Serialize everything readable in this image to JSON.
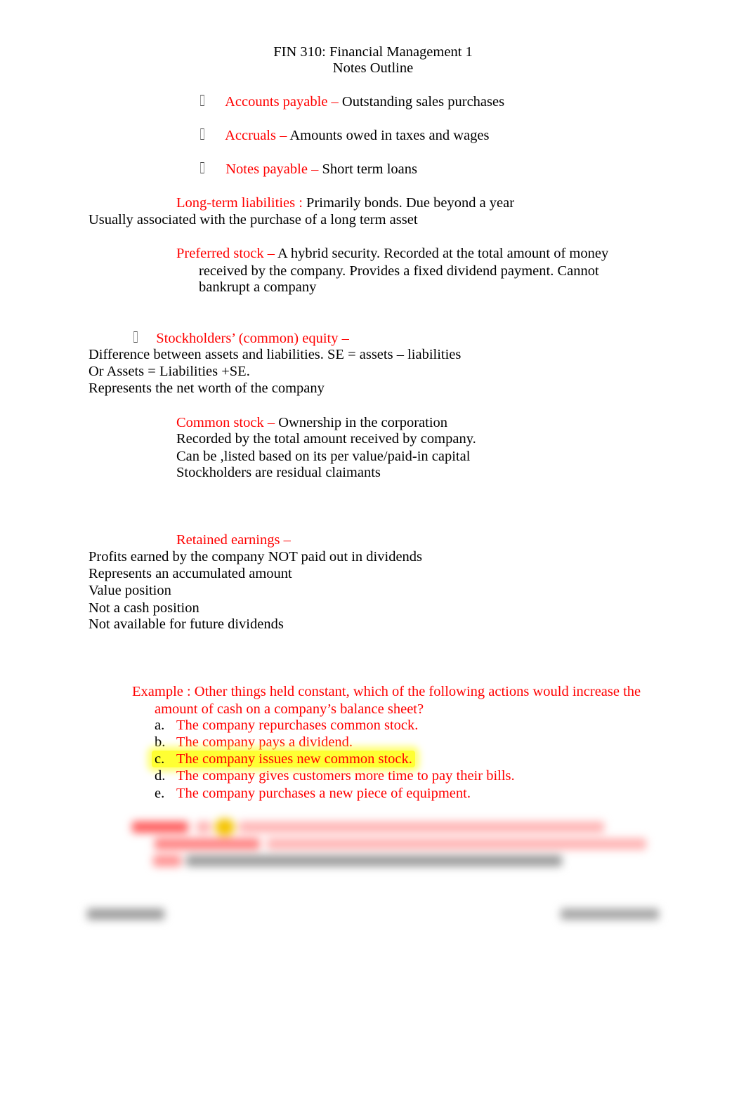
{
  "header": {
    "title": "FIN 310: Financial Management 1",
    "subtitle": "Notes Outline"
  },
  "current_liabilities": [
    {
      "term": "Accounts payable",
      "sep": " – ",
      "definition": "Outstanding sales purchases",
      "bullet_icon": "square-bullet"
    },
    {
      "term": "Accruals",
      "sep": " – ",
      "definition": "Amounts owed in taxes and wages",
      "bullet_icon": "square-bullet"
    },
    {
      "term": "Notes payable",
      "sep": " – ",
      "definition": "Short term loans",
      "bullet_icon": "square-bullet"
    }
  ],
  "long_term": {
    "term": "Long-term liabilities",
    "sep": " : ",
    "definition": "Primarily bonds. Due beyond a year",
    "note": "Usually associated with the purchase of a long term asset"
  },
  "preferred": {
    "term": "Preferred stock",
    "sep": "  – ",
    "line1": "A hybrid security. Recorded at the total amount of money",
    "line2": "received by the company. Provides a fixed dividend payment. Cannot",
    "line3": "bankrupt a company"
  },
  "equity": {
    "term": "Stockholders’ (common) equity",
    "sep": "  –",
    "lines": [
      "Difference between assets and liabilities. SE = assets – liabilities",
      "Or Assets = Liabilities +SE.",
      "Represents the net worth of the company"
    ]
  },
  "common_stock": {
    "term": "Common stock",
    "sep": " – ",
    "definition": "Ownership in the corporation",
    "lines": [
      "Recorded by the total amount received by company.",
      "Can be ,listed based on its per value/paid-in capital",
      "Stockholders are residual claimants"
    ]
  },
  "retained": {
    "term": "Retained earnings",
    "sep": "  –",
    "lines": [
      "Profits earned by the company NOT paid out in dividends",
      "Represents an accumulated amount",
      "Value position",
      "Not a cash position",
      "Not available for future dividends"
    ]
  },
  "example": {
    "question_line1": "Example : Other things held constant, which of the following actions would increase the",
    "question_line2": "amount of cash on a company’s balance sheet?",
    "options": [
      {
        "letter": "a.",
        "text": "The company repurchases common stock.",
        "highlighted": false
      },
      {
        "letter": "b.",
        "text": "The company pays a dividend.",
        "highlighted": false
      },
      {
        "letter": "c.",
        "text": "The company issues new common stock.",
        "highlighted": true
      },
      {
        "letter": "d.",
        "text": "The company gives customers more time to pay their bills.",
        "highlighted": false
      },
      {
        "letter": "e.",
        "text": "The company purchases a new piece of equipment.",
        "highlighted": false
      }
    ]
  },
  "colors": {
    "accent_red": "#ff0000",
    "highlight_yellow": "#ffff33",
    "text": "#000000"
  }
}
